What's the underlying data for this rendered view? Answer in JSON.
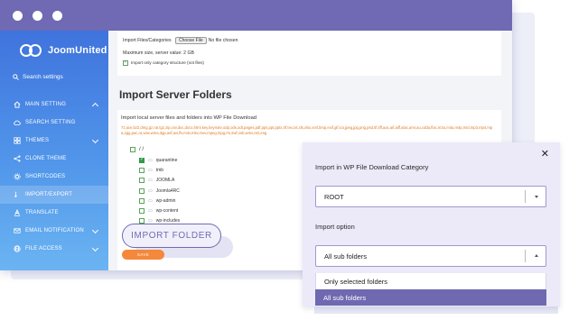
{
  "sidebar": {
    "logo_text": "JoomUnited",
    "search_placeholder": "Search settings",
    "items": [
      {
        "label": "MAIN SETTING",
        "icon": "home-icon",
        "chevron": "up"
      },
      {
        "label": "SEARCH SETTING",
        "icon": "cloud-icon",
        "chevron": ""
      },
      {
        "label": "THEMES",
        "icon": "grid-icon",
        "chevron": "down"
      },
      {
        "label": "CLONE THEME",
        "icon": "share-icon",
        "chevron": ""
      },
      {
        "label": "SHORTCODES",
        "icon": "gear-icon",
        "chevron": ""
      },
      {
        "label": "IMPORT/EXPORT",
        "icon": "arrows-icon",
        "chevron": ""
      },
      {
        "label": "TRANSLATE",
        "icon": "translate-icon",
        "chevron": ""
      },
      {
        "label": "EMAIL NOTIFICATION",
        "icon": "mail-icon",
        "chevron": "down"
      },
      {
        "label": "FILE ACCESS",
        "icon": "globe-icon",
        "chevron": "down"
      }
    ]
  },
  "import_files": {
    "label": "Import Files/Categories",
    "choose_btn": "Choose File",
    "no_file": "No file chosen",
    "max_size": "Maximum size, server value: 2 GB",
    "only_structure": "Import only category structure (not files)"
  },
  "server_folders": {
    "title": "Import Server Folders",
    "description": "Import local server files and folders into WP File Download",
    "extensions": "7z,ace,bz2,dmg,gz,rar,tgz,zip,csv,doc,docx,html,key,keynote,odp,ods,odt,pages,pdf,pps,ppt,pptx,rtf,tex,txt,xls,xlsx,xml,bmp,exif,gif,ico,jpeg,jpg,png,psd,tif,tiff,aac,aif,aiff,alac,amr,au,cdda,flac,m3u,m4a,m4p,mid,mp3,mp4,mpa,ogg,pac,ra,wav,wma,3gp,asf,avi,flv,m4v,mkv,mov,mpeg,mpg,rm,swf,vob,wmv,css,img",
    "root": "/ /",
    "folders": [
      {
        "name": "quarantine",
        "checked": true
      },
      {
        "name": "tmb",
        "checked": false
      },
      {
        "name": "JOOMLA",
        "checked": false
      },
      {
        "name": "Joomla4RC",
        "checked": false
      },
      {
        "name": "wp-admin",
        "checked": false
      },
      {
        "name": "wp-content",
        "checked": false
      },
      {
        "name": "wp-includes",
        "checked": false
      }
    ],
    "import_button": "IMPORT FOLDER",
    "save_button": "SAVE"
  },
  "dialog": {
    "close_symbol": "✕",
    "category_label": "Import in WP File Download Category",
    "category_value": "ROOT",
    "option_label": "Import option",
    "option_value": "All sub folders",
    "options": [
      "Only selected folders",
      "All sub folders"
    ],
    "selected_option": "All sub folders"
  },
  "colors": {
    "titlebar": "#6f6ab3",
    "sidebar_top": "#3f73dd",
    "sidebar_bottom": "#6bb4f2",
    "accent": "#6e69b0",
    "orange": "#f5883a"
  }
}
